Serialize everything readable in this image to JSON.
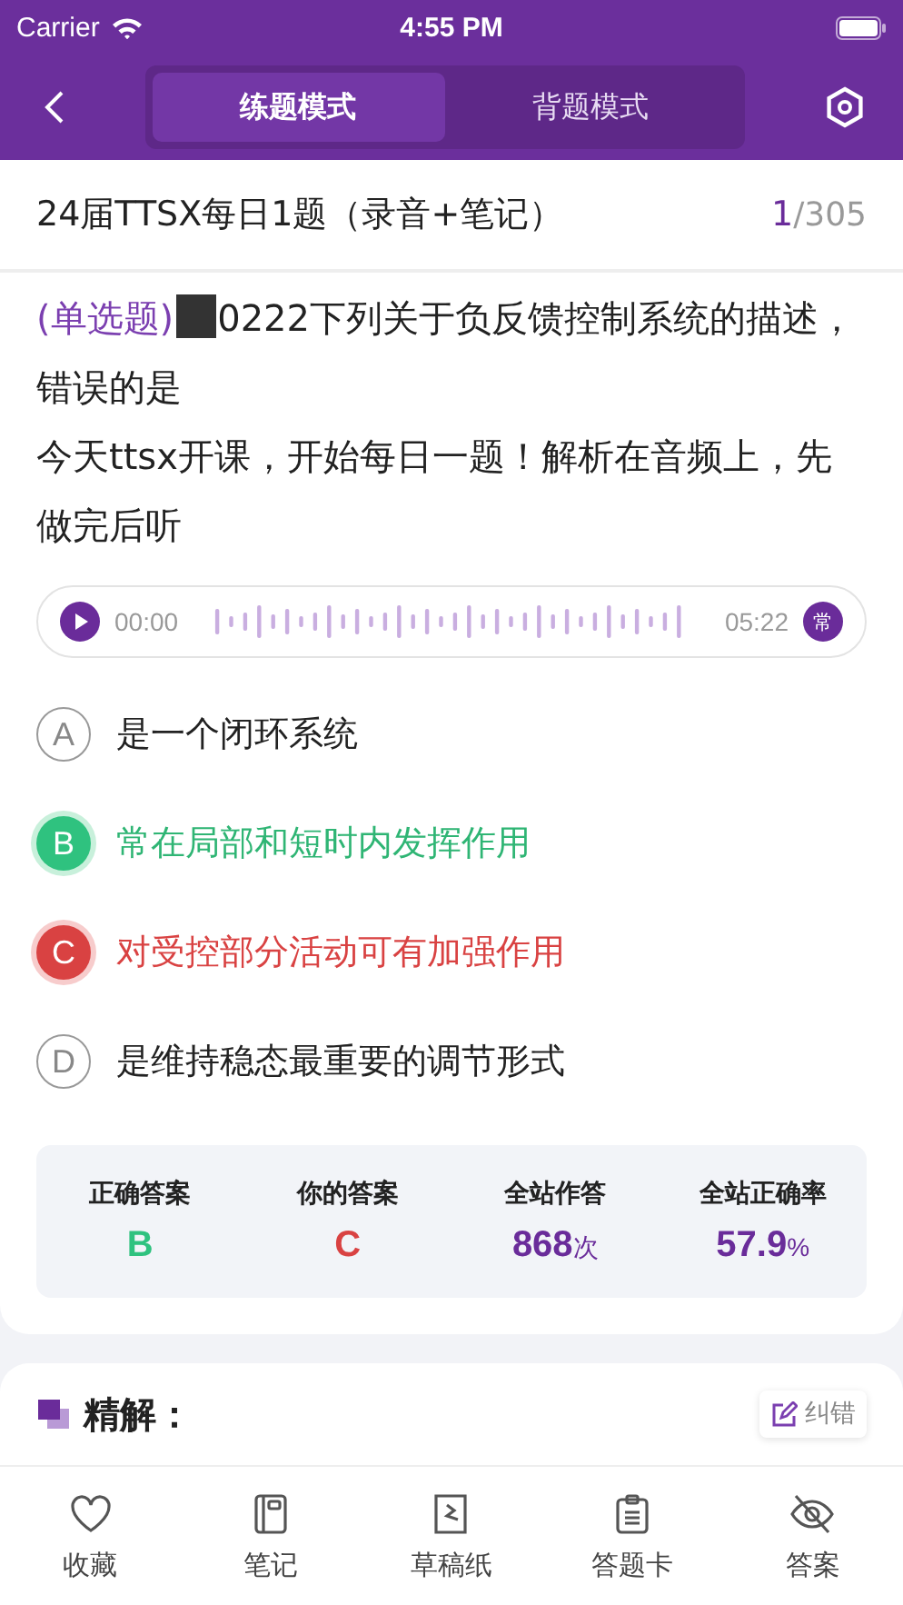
{
  "status_bar": {
    "carrier": "Carrier",
    "time": "4:55 PM"
  },
  "nav": {
    "tabs": [
      {
        "label": "练题模式",
        "selected": true
      },
      {
        "label": "背题模式",
        "selected": false
      }
    ]
  },
  "header": {
    "title": "24届TTSX每日1题（录音+笔记）",
    "current": "1",
    "total": "/305"
  },
  "question": {
    "type_label": "(单选题)",
    "text": "0222下列关于负反馈控制系统的描述，错误的是",
    "note": "今天ttsx开课，开始每日一题！解析在音频上，先做完后听"
  },
  "audio": {
    "start": "00:00",
    "end": "05:22",
    "speed": "常"
  },
  "options": [
    {
      "letter": "A",
      "text": "是一个闭环系统",
      "kind": "neutral"
    },
    {
      "letter": "B",
      "text": "常在局部和短时内发挥作用",
      "kind": "correct"
    },
    {
      "letter": "C",
      "text": "对受控部分活动可有加强作用",
      "kind": "wrong"
    },
    {
      "letter": "D",
      "text": "是维持稳态最重要的调节形式",
      "kind": "neutral"
    }
  ],
  "stats": [
    {
      "label": "正确答案",
      "value": "B",
      "kind": "correct"
    },
    {
      "label": "你的答案",
      "value": "C",
      "kind": "wrong"
    },
    {
      "label": "全站作答",
      "value": "868",
      "unit": "次",
      "kind": "accent"
    },
    {
      "label": "全站正确率",
      "value": "57.9",
      "unit": "%",
      "kind": "accent"
    }
  ],
  "explanation": {
    "title": "精解：",
    "report_button": "纠错"
  },
  "tab_bar": [
    {
      "label": "收藏"
    },
    {
      "label": "笔记"
    },
    {
      "label": "草稿纸"
    },
    {
      "label": "答题卡"
    },
    {
      "label": "答案"
    }
  ]
}
